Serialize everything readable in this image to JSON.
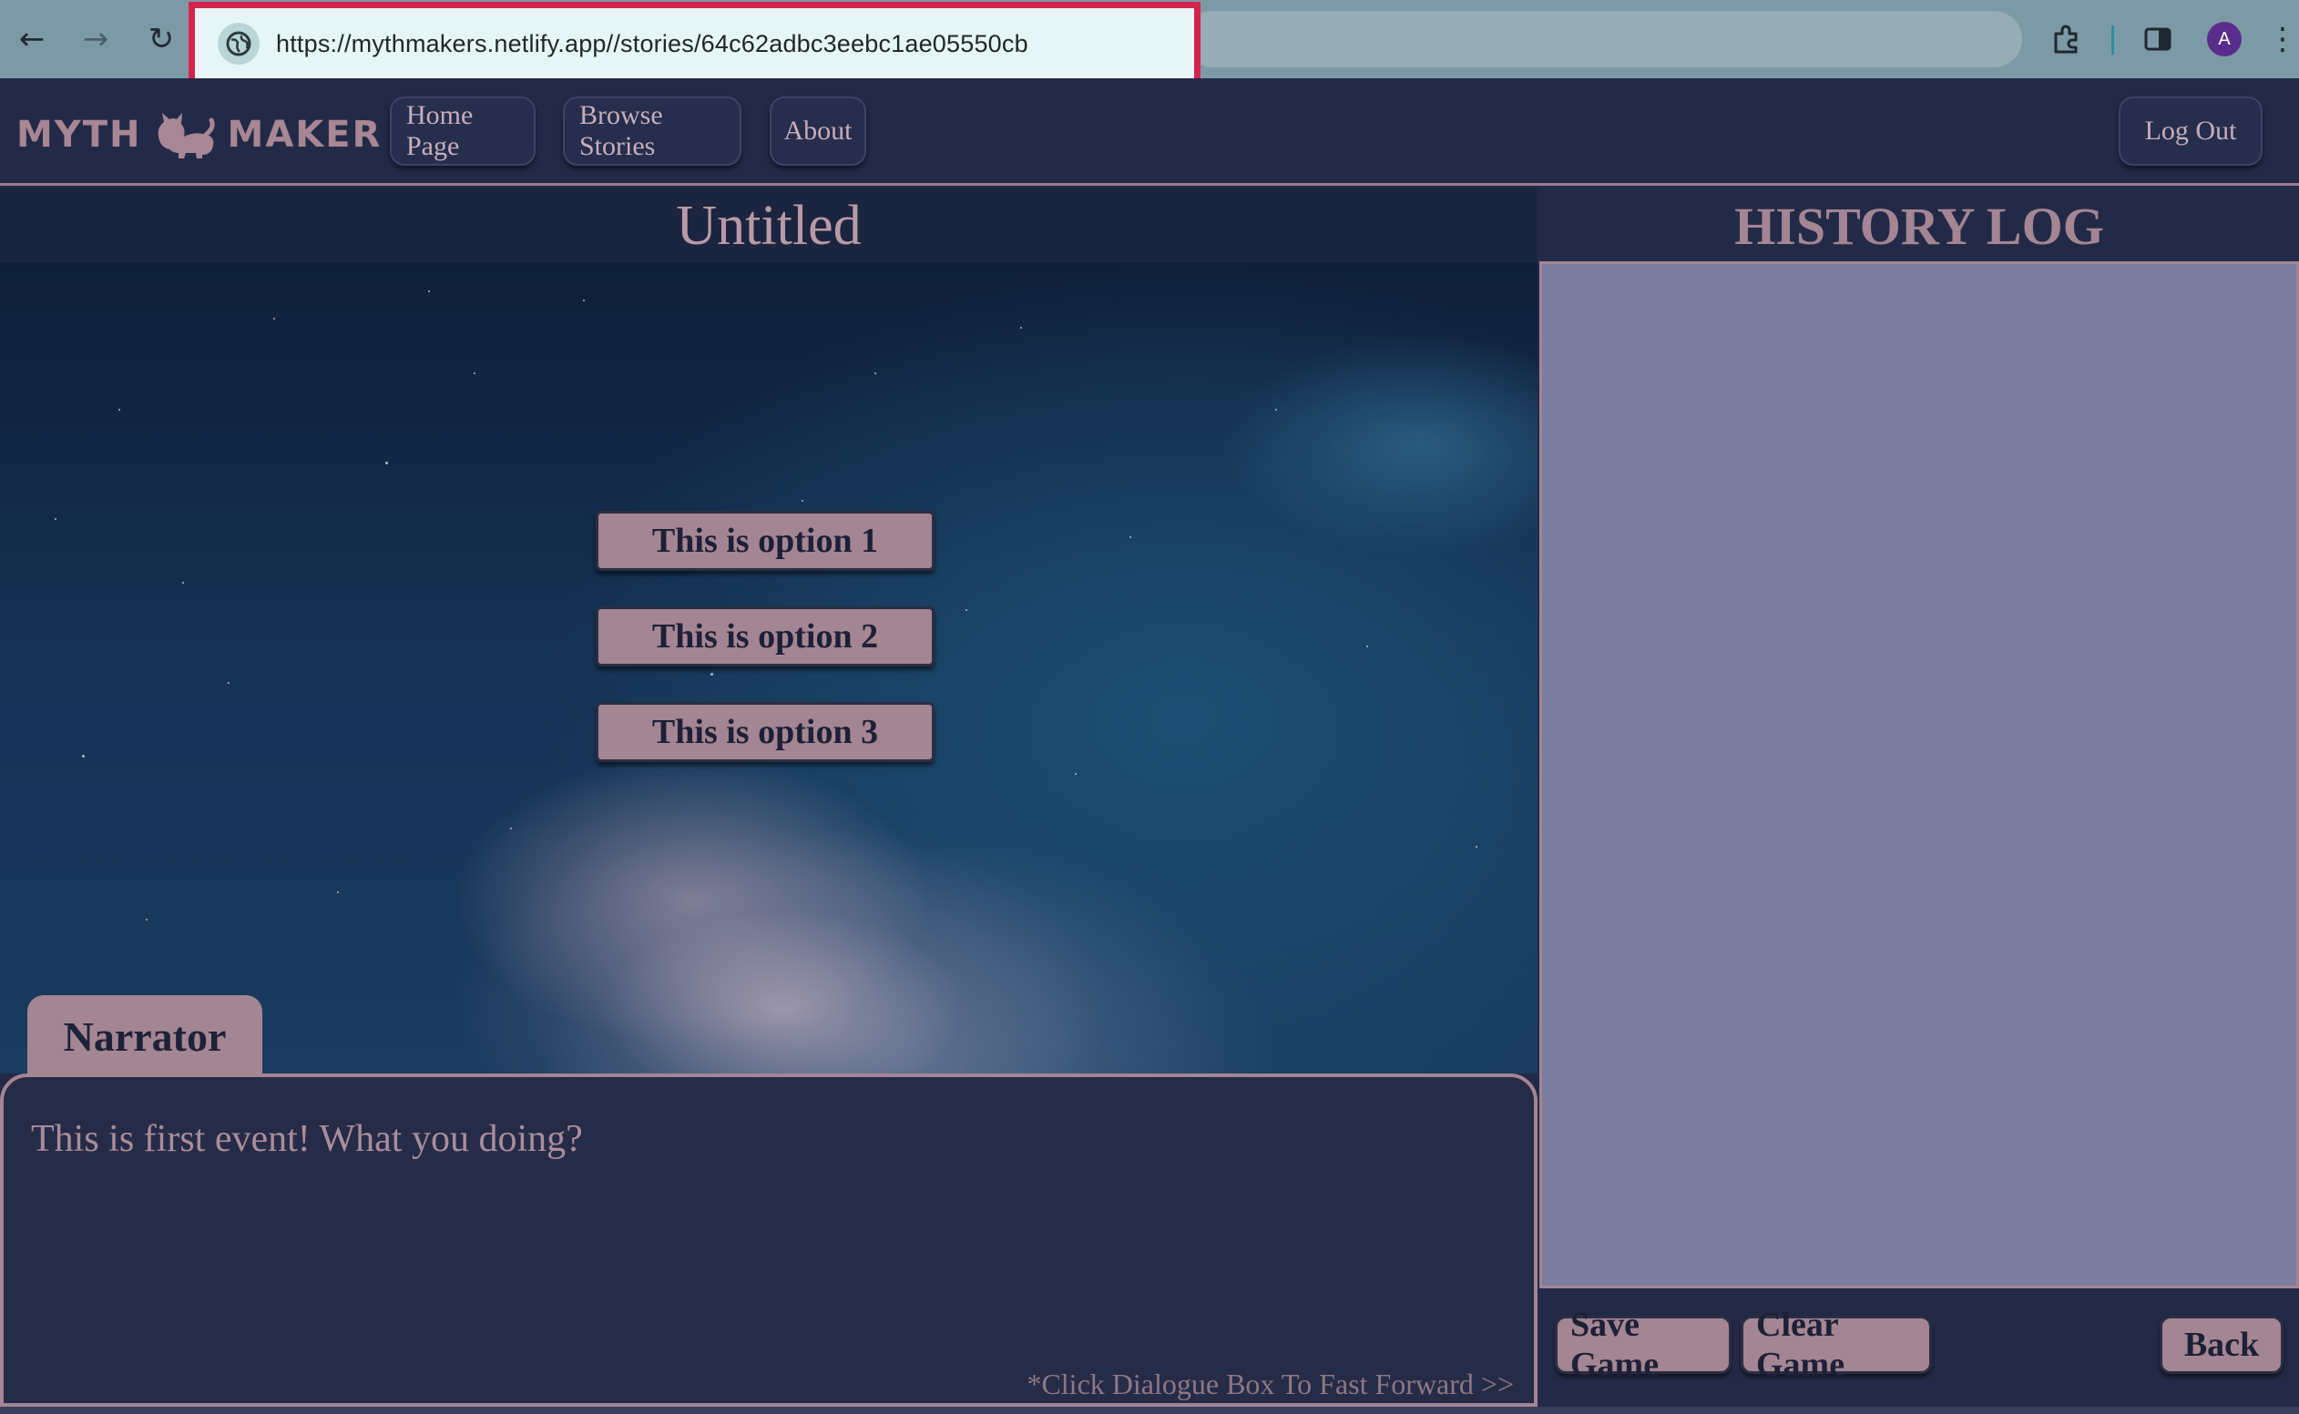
{
  "browser": {
    "url": "https://mythmakers.netlify.app//stories/64c62adbc3eebc1ae05550cb",
    "profile_initial": "A",
    "icons": {
      "back": "back-arrow-icon",
      "forward": "forward-arrow-icon",
      "reload": "reload-icon",
      "site_info": "globe-icon",
      "extensions": "puzzle-piece-icon",
      "side_panel": "side-panel-icon",
      "menu": "kebab-menu-icon"
    }
  },
  "header": {
    "logo_left": "MYTH",
    "logo_right": "MAKER",
    "nav": [
      "Home Page",
      "Browse Stories",
      "About"
    ],
    "logout_label": "Log Out"
  },
  "game": {
    "title": "Untitled",
    "options": [
      "This is option 1",
      "This is option 2",
      "This is option 3"
    ],
    "speaker": "Narrator",
    "dialogue": "This is first event! What you doing?",
    "fast_forward_hint": "*Click Dialogue Box To Fast Forward >>"
  },
  "history": {
    "title": "HISTORY LOG",
    "entries": [],
    "save_label": "Save Game",
    "clear_label": "Clear Game",
    "back_label": "Back"
  },
  "colors": {
    "accent": "#a48593",
    "background": "#232a48",
    "history_panel": "#7a7d9e",
    "url_highlight": "#d4244e"
  }
}
